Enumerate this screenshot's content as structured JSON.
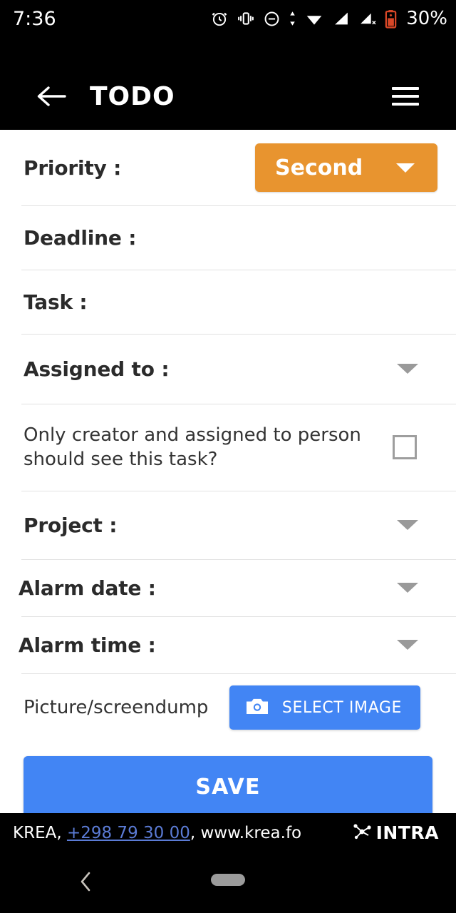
{
  "status_bar": {
    "time": "7:36",
    "battery_percent": "30%",
    "icons": [
      "alarm-icon",
      "vibrate-icon",
      "do-not-disturb-icon",
      "data-transfer-icon",
      "wifi-icon",
      "signal-icon",
      "signal-no-sim-icon",
      "battery-charging-icon"
    ]
  },
  "app_bar": {
    "back_label": "back-arrow-icon",
    "title": "TODO",
    "menu_label": "hamburger-menu-icon"
  },
  "form": {
    "priority": {
      "label": "Priority :",
      "value": "Second",
      "accent_color": "#e8942f"
    },
    "deadline": {
      "label": "Deadline :",
      "value": ""
    },
    "task": {
      "label": "Task :",
      "value": ""
    },
    "assigned_to": {
      "label": "Assigned to :",
      "value": ""
    },
    "private": {
      "label": "Only creator and assigned to person should see this task?",
      "checked": false
    },
    "project": {
      "label": "Project :",
      "value": ""
    },
    "alarm_date": {
      "label": "Alarm date :",
      "value": ""
    },
    "alarm_time": {
      "label": "Alarm time :",
      "value": ""
    },
    "picture": {
      "label": "Picture/screendump",
      "button_label": "SELECT IMAGE",
      "button_color": "#4285f4"
    },
    "save": {
      "label": "SAVE",
      "button_color": "#4285f4"
    }
  },
  "footer": {
    "prefix": "KREA, ",
    "phone": "+298 79 30 00",
    "suffix": ", www.krea.fo",
    "brand": "INTRA",
    "phone_link_color": "#5b7bd5"
  },
  "nav_bar": {
    "back": "nav-back-chevron-icon",
    "home": "nav-home-pill-icon"
  }
}
